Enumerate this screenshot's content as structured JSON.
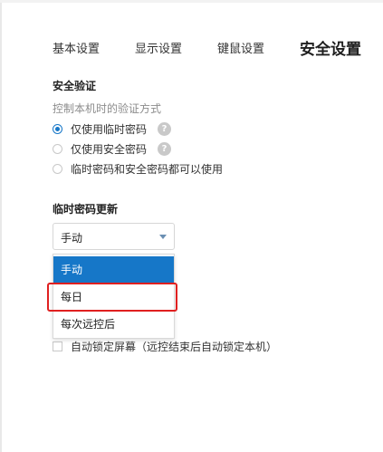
{
  "tabs": [
    {
      "label": "基本设置"
    },
    {
      "label": "显示设置"
    },
    {
      "label": "键鼠设置"
    },
    {
      "label": "安全设置"
    }
  ],
  "verification": {
    "title": "安全验证",
    "hint": "控制本机时的验证方式",
    "options": [
      {
        "label": "仅使用临时密码",
        "checked": true,
        "help": "?"
      },
      {
        "label": "仅使用安全密码",
        "checked": false,
        "help": "?"
      },
      {
        "label": "临时密码和安全密码都可以使用",
        "checked": false
      }
    ]
  },
  "temp_password_update": {
    "title": "临时密码更新",
    "selected": "手动",
    "options": [
      {
        "label": "手动"
      },
      {
        "label": "每日"
      },
      {
        "label": "每次远控后"
      }
    ]
  },
  "auto_lock": {
    "label": "自动锁定屏幕（远控结束后自动锁定本机）",
    "checked": false
  },
  "colors": {
    "accent": "#1677c8",
    "highlight": "#e02020"
  }
}
